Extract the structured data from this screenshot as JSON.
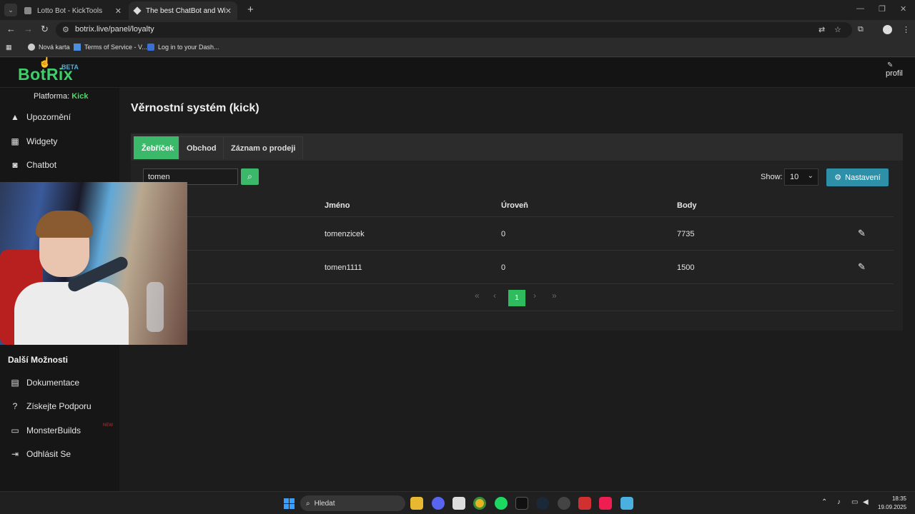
{
  "browser": {
    "tabs": [
      {
        "title": "Lotto Bot - KickTools"
      },
      {
        "title": "The best ChatBot and Widgets"
      }
    ],
    "url": "botrix.live/panel/loyalty",
    "bookmarks": [
      {
        "label": "Nová karta"
      },
      {
        "label": "Terms of Service - V..."
      },
      {
        "label": "Log in to your Dash..."
      }
    ]
  },
  "header": {
    "logo": "BotRix",
    "beta": "BETA",
    "profile_label": "profil"
  },
  "sidebar": {
    "platform_label": "Platforma:",
    "platform_value": "Kick",
    "items": [
      {
        "label": "Upozornění",
        "icon": "warning-icon"
      },
      {
        "label": "Widgety",
        "icon": "widgets-icon"
      },
      {
        "label": "Chatbot",
        "icon": "robot-icon"
      }
    ],
    "more_heading": "Další Možnosti",
    "more_items": [
      {
        "label": "Dokumentace",
        "icon": "docs-icon"
      },
      {
        "label": "Získejte Podporu",
        "icon": "help-icon"
      },
      {
        "label": "MonsterBuilds",
        "icon": "laptop-icon"
      },
      {
        "label": "Odhlásit Se",
        "icon": "logout-icon"
      }
    ],
    "new_badge": "NEW"
  },
  "main": {
    "page_title": "Věrnostní systém (kick)",
    "tabs": [
      {
        "label": "Žebříček",
        "active": true
      },
      {
        "label": "Obchod",
        "active": false
      },
      {
        "label": "Záznam o prodeji",
        "active": false
      }
    ],
    "search_value": "tomen",
    "show_label": "Show:",
    "show_value": "10",
    "settings_label": "Nastavení",
    "table": {
      "headers": [
        "Jméno",
        "Úroveň",
        "Body"
      ],
      "rows": [
        {
          "name": "tomenzicek",
          "level": "0",
          "points": "7735"
        },
        {
          "name": "tomen1111",
          "level": "0",
          "points": "1500"
        }
      ]
    },
    "pagination": {
      "current_page": "1"
    }
  },
  "taskbar": {
    "search_placeholder": "Hledat",
    "time": "18:35",
    "date": "19.09.2025"
  },
  "colors": {
    "accent_green": "#3bb86a",
    "settings_teal": "#2e8fa8",
    "platform_green": "#53d768",
    "beta_blue": "#4fb0e0"
  }
}
